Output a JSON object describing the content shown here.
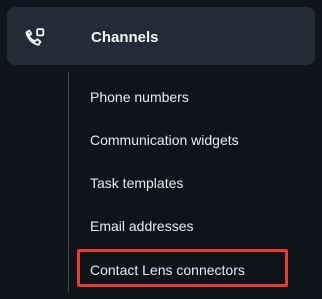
{
  "section": {
    "title": "Channels",
    "icon": "channels-icon"
  },
  "subnav": {
    "items": [
      {
        "label": "Phone numbers"
      },
      {
        "label": "Communication widgets"
      },
      {
        "label": "Task templates"
      },
      {
        "label": "Email addresses"
      },
      {
        "label": "Contact Lens connectors",
        "highlighted": true
      }
    ]
  },
  "colors": {
    "background": "#0f141a",
    "section_header_background": "#232b37",
    "text": "#e7ecf1",
    "highlight_border": "#e63b2e",
    "tree_line": "#3e4957"
  }
}
